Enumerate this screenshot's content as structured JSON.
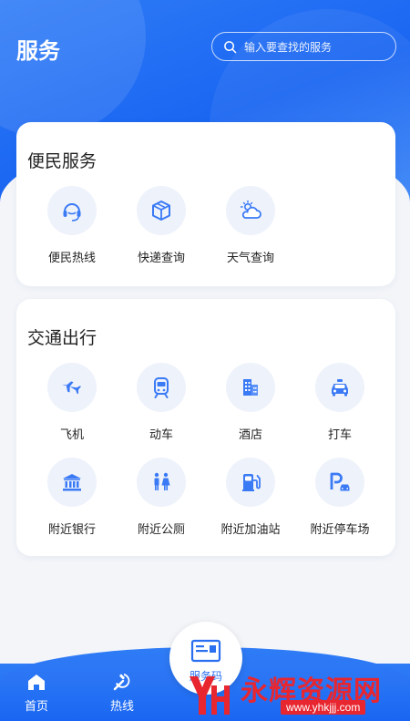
{
  "header": {
    "title": "服务",
    "search_placeholder": "输入要查找的服务"
  },
  "sections": [
    {
      "title": "便民服务",
      "items": [
        {
          "label": "便民热线",
          "icon": "headset-icon"
        },
        {
          "label": "快递查询",
          "icon": "package-icon"
        },
        {
          "label": "天气查询",
          "icon": "weather-icon"
        }
      ]
    },
    {
      "title": "交通出行",
      "items": [
        {
          "label": "飞机",
          "icon": "airplane-icon"
        },
        {
          "label": "动车",
          "icon": "train-icon"
        },
        {
          "label": "酒店",
          "icon": "hotel-icon"
        },
        {
          "label": "打车",
          "icon": "taxi-icon"
        },
        {
          "label": "附近银行",
          "icon": "bank-icon"
        },
        {
          "label": "附近公厕",
          "icon": "restroom-icon"
        },
        {
          "label": "附近加油站",
          "icon": "gas-station-icon"
        },
        {
          "label": "附近停车场",
          "icon": "parking-icon"
        }
      ]
    }
  ],
  "tabbar": {
    "home_label": "首页",
    "hotline_label": "热线",
    "center_label": "服务码"
  },
  "watermark": {
    "title": "永辉资源网",
    "url": "www.yhkjjj.com"
  },
  "colors": {
    "primary": "#1a66f2",
    "icon": "#3a7af5",
    "icon_bg": "#eef2fb",
    "watermark": "#e8262f"
  }
}
